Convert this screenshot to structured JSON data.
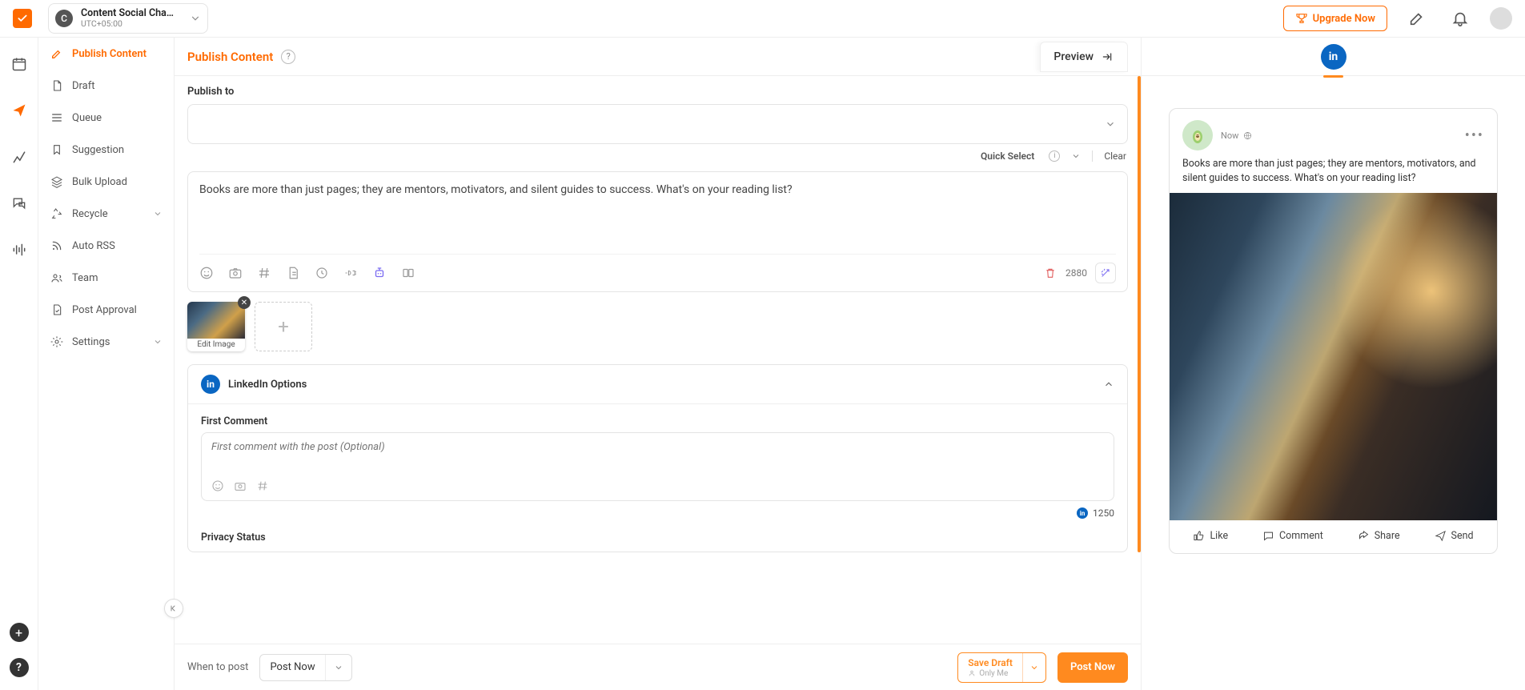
{
  "topbar": {
    "workspace": {
      "initial": "C",
      "name": "Content Social Cha…",
      "tz": "UTC+05:00"
    },
    "upgrade": "Upgrade Now"
  },
  "menu": {
    "items": [
      {
        "label": "Publish Content",
        "active": true
      },
      {
        "label": "Draft"
      },
      {
        "label": "Queue"
      },
      {
        "label": "Suggestion"
      },
      {
        "label": "Bulk Upload"
      },
      {
        "label": "Recycle",
        "chev": true
      },
      {
        "label": "Auto RSS"
      },
      {
        "label": "Team"
      },
      {
        "label": "Post Approval"
      },
      {
        "label": "Settings",
        "chev": true
      }
    ]
  },
  "composer": {
    "header_title": "Publish Content",
    "preview_tab": "Preview",
    "publish_to_label": "Publish to",
    "quick_select": "Quick Select",
    "clear": "Clear",
    "text": "Books are more than just pages; they are mentors, motivators, and silent guides to success. What's on your reading list?",
    "char_count": "2880",
    "edit_image": "Edit Image",
    "linkedin_options": "LinkedIn Options",
    "first_comment_label": "First Comment",
    "first_comment_placeholder": "First comment with the post (Optional)",
    "li_count": "1250",
    "privacy_label": "Privacy Status",
    "when_label": "When to post",
    "when_value": "Post Now",
    "save_draft": "Save Draft",
    "only_me": "Only Me",
    "post_now_btn": "Post Now"
  },
  "preview": {
    "now": "Now",
    "text": "Books are more than just pages; they are mentors, motivators, and silent guides to success. What's on your reading list?",
    "like": "Like",
    "comment": "Comment",
    "share": "Share",
    "send": "Send"
  }
}
